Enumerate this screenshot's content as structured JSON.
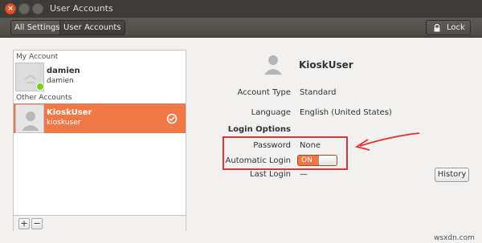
{
  "window": {
    "title": "User Accounts"
  },
  "toolbar": {
    "crumbs": [
      "All Settings",
      "User Accounts"
    ],
    "lock_label": "Lock"
  },
  "sidebar": {
    "my_account_label": "My Account",
    "other_accounts_label": "Other Accounts",
    "users": [
      {
        "name": "damien",
        "login": "damien"
      },
      {
        "name": "KioskUser",
        "login": "kioskuser"
      }
    ],
    "add_label": "+",
    "remove_label": "−"
  },
  "detail": {
    "account_name": "KioskUser",
    "fields": {
      "account_type_label": "Account Type",
      "account_type_value": "Standard",
      "language_label": "Language",
      "language_value": "English (United States)",
      "login_options_label": "Login Options",
      "password_label": "Password",
      "password_value": "None",
      "auto_login_label": "Automatic Login",
      "auto_login_value": "ON",
      "last_login_label": "Last Login",
      "last_login_value": "—"
    },
    "history_label": "History"
  },
  "annotation": {
    "color": "#e53232"
  },
  "colors": {
    "accent": "#f07746",
    "titlebar": "#3c3b37",
    "close": "#e0552b",
    "online": "#73d216"
  },
  "watermark": "wsxdn.com"
}
